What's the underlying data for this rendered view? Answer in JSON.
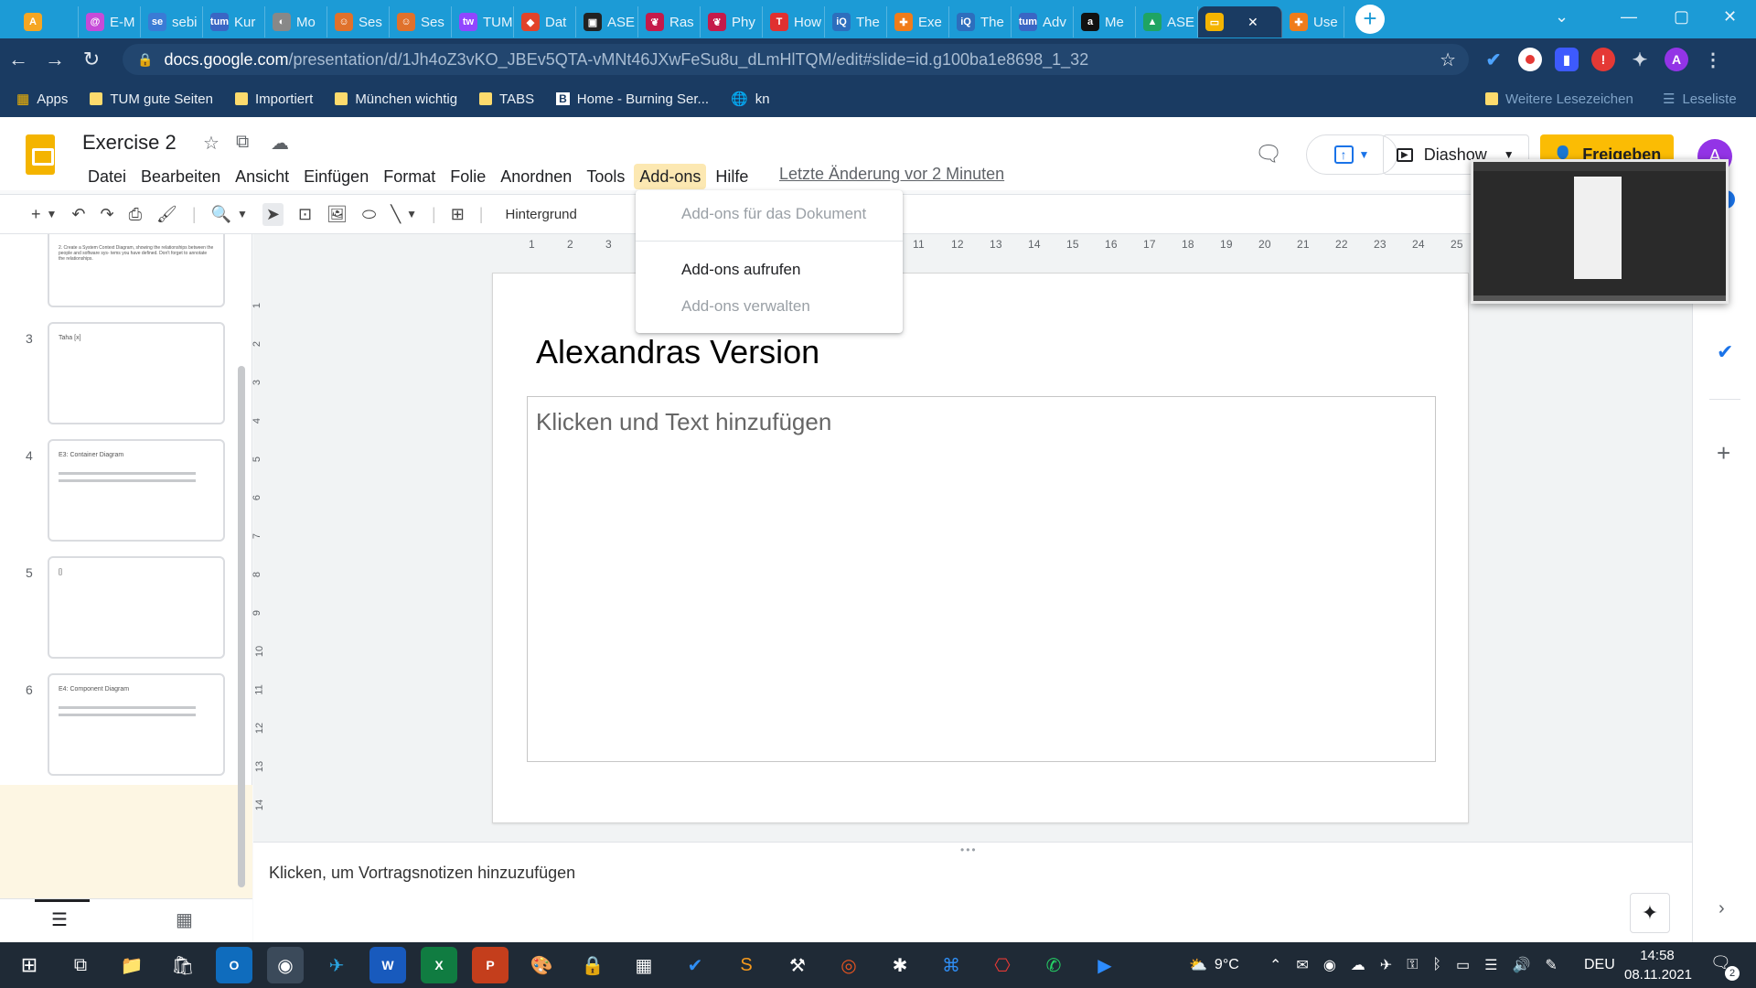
{
  "browser": {
    "tabs": [
      {
        "label": "",
        "color": "#f5a623",
        "icon": "A",
        "active": false
      },
      {
        "label": "E-M",
        "color": "#c64bd8",
        "icon": "@",
        "active": false
      },
      {
        "label": "sebi",
        "color": "#3a7bd5",
        "icon": "se",
        "active": false
      },
      {
        "label": "Kur",
        "color": "#3a66c4",
        "icon": "tum",
        "active": false
      },
      {
        "label": "Mo",
        "color": "#888888",
        "icon": "◐",
        "active": false
      },
      {
        "label": "Ses",
        "color": "#e0712b",
        "icon": "☺",
        "active": false
      },
      {
        "label": "Ses",
        "color": "#e0712b",
        "icon": "☺",
        "active": false
      },
      {
        "label": "TUM",
        "color": "#9146ff",
        "icon": "tw",
        "active": false
      },
      {
        "label": "Dat",
        "color": "#e24329",
        "icon": "◆",
        "active": false
      },
      {
        "label": "ASE",
        "color": "#222222",
        "icon": "▣",
        "active": false
      },
      {
        "label": "Ras",
        "color": "#c51a4a",
        "icon": "❦",
        "active": false
      },
      {
        "label": "Phy",
        "color": "#c51a4a",
        "icon": "❦",
        "active": false
      },
      {
        "label": "How",
        "color": "#e03030",
        "icon": "T",
        "active": false
      },
      {
        "label": "The",
        "color": "#2d6ebd",
        "icon": "iQ",
        "active": false
      },
      {
        "label": "Exe",
        "color": "#f07c1a",
        "icon": "✚",
        "active": false
      },
      {
        "label": "The",
        "color": "#2d6ebd",
        "icon": "iQ",
        "active": false
      },
      {
        "label": "Adv",
        "color": "#3a66c4",
        "icon": "tum",
        "active": false
      },
      {
        "label": "Me",
        "color": "#111111",
        "icon": "a",
        "active": false
      },
      {
        "label": "ASE",
        "color": "#1fa463",
        "icon": "▲",
        "active": false
      },
      {
        "label": "",
        "color": "#f4b400",
        "icon": "▭",
        "active": true
      },
      {
        "label": "Use",
        "color": "#f07c1a",
        "icon": "✚",
        "active": false
      }
    ],
    "url_host": "docs.google.com",
    "url_path": "/presentation/d/1Jh4oZ3vKO_JBEv5QTA-vMNt46JXwFeSu8u_dLmHlTQM/edit#slide=id.g100ba1e8698_1_32",
    "profile_initial": "A",
    "bookmarks": [
      {
        "label": "Apps",
        "kind": "apps-grid-icon"
      },
      {
        "label": "TUM gute Seiten",
        "kind": "folder-icon"
      },
      {
        "label": "Importiert",
        "kind": "folder-icon"
      },
      {
        "label": "München wichtig",
        "kind": "folder-icon"
      },
      {
        "label": "TABS",
        "kind": "folder-icon"
      },
      {
        "label": "Home - Burning Ser...",
        "kind": "site-icon"
      },
      {
        "label": "kn",
        "kind": "globe-icon"
      }
    ],
    "bookmarks_right": [
      "Weitere Lesezeichen",
      "Leseliste"
    ]
  },
  "doc": {
    "title": "Exercise 2",
    "menus": [
      "Datei",
      "Bearbeiten",
      "Ansicht",
      "Einfügen",
      "Format",
      "Folie",
      "Anordnen",
      "Tools",
      "Add-ons",
      "Hilfe"
    ],
    "open_menu": "Add-ons",
    "last_edit": "Letzte Änderung vor 2 Minuten",
    "slideshow_label": "Diashow",
    "share_label": "Freigeben",
    "user_initial": "A",
    "background_button": "Hintergrund"
  },
  "addons_menu": {
    "items": [
      {
        "label": "Add-ons für das Dokument",
        "enabled": false
      },
      {
        "label": "Add-ons aufrufen",
        "enabled": true
      },
      {
        "label": "Add-ons verwalten",
        "enabled": false
      }
    ]
  },
  "filmstrip": {
    "slides": [
      {
        "number": "",
        "title": "2. Create a System Context Diagram, showing the relationships between the people and software sys- tems you have defined. Don't forget to annotate the relationships."
      },
      {
        "number": "3",
        "title": "Taha [x]"
      },
      {
        "number": "4",
        "title": "E3: Container Diagram"
      },
      {
        "number": "5",
        "title": "[]"
      },
      {
        "number": "6",
        "title": "E4: Component Diagram"
      },
      {
        "number": "7",
        "title": "Alexandras Version"
      }
    ],
    "current": "7"
  },
  "ruler": {
    "h_ticks": [
      "1",
      "2",
      "3",
      "",
      "",
      "",
      "",
      "",
      "",
      "",
      "11",
      "12",
      "13",
      "14",
      "15",
      "16",
      "17",
      "18",
      "19",
      "20",
      "21",
      "22",
      "23",
      "24",
      "25"
    ],
    "v_ticks": [
      "1",
      "2",
      "3",
      "4",
      "5",
      "6",
      "7",
      "8",
      "9",
      "10",
      "11",
      "12",
      "13",
      "14"
    ]
  },
  "slide": {
    "title": "Alexandras Version",
    "body_placeholder": "Klicken und Text hinzufügen"
  },
  "notes": {
    "placeholder": "Klicken, um Vortragsnotizen hinzuzufügen"
  },
  "taskbar": {
    "weather": "9°C",
    "language": "DEU",
    "time": "14:58",
    "date": "08.11.2021",
    "notifications": "2"
  }
}
